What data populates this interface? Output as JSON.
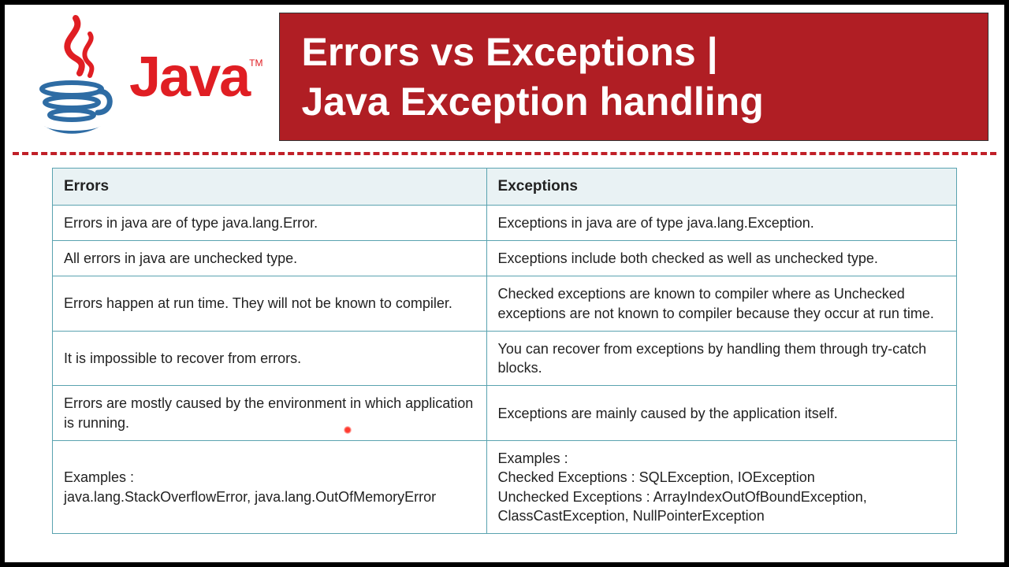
{
  "logo": {
    "text": "Java",
    "tm": "TM"
  },
  "title": {
    "line1": "Errors vs Exceptions |",
    "line2": "Java Exception handling"
  },
  "table": {
    "headers": {
      "a": "Errors",
      "b": "Exceptions"
    },
    "rows": [
      {
        "a": "Errors in java are of type java.lang.Error.",
        "b": "Exceptions in java are of type java.lang.Exception."
      },
      {
        "a": "All errors in java are unchecked type.",
        "b": "Exceptions include both checked as well as unchecked type."
      },
      {
        "a": "Errors happen at run time. They will not be known to compiler.",
        "b": "Checked exceptions are known to compiler where as Unchecked exceptions are not known to compiler because they occur at run time."
      },
      {
        "a": "It is impossible to recover from errors.",
        "b": "You can recover from exceptions by handling them through try-catch blocks."
      },
      {
        "a": "Errors are mostly caused by the environment in which application is running.",
        "b": "Exceptions are mainly caused by the application itself."
      },
      {
        "a": "Examples :\njava.lang.StackOverflowError, java.lang.OutOfMemoryError",
        "b": "Examples :\nChecked Exceptions : SQLException, IOException\nUnchecked Exceptions : ArrayIndexOutOfBoundException, ClassCastException, NullPointerException"
      }
    ]
  }
}
